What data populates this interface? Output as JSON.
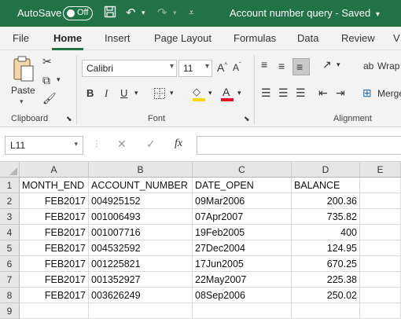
{
  "titlebar": {
    "autosave_label": "AutoSave",
    "toggle_state": "Off",
    "doc_title": "Account number query - Saved",
    "title_arrow": "▾"
  },
  "menu": [
    "File",
    "Home",
    "Insert",
    "Page Layout",
    "Formulas",
    "Data",
    "Review",
    "V"
  ],
  "ribbon": {
    "paste_label": "Paste",
    "font_name": "Calibri",
    "font_size": "11",
    "clipboard_label": "Clipboard",
    "font_label": "Font",
    "alignment_label": "Alignment",
    "bold": "B",
    "italic": "I",
    "underline": "U",
    "grow_font": "A^",
    "shrink_font": "Aˇ",
    "wrap_text": "Wrap",
    "merge": "Merge"
  },
  "formula_bar": {
    "name_box": "L11",
    "cancel": "✕",
    "enter": "✓",
    "fx": "fx",
    "value": ""
  },
  "sheet": {
    "columns": [
      "A",
      "B",
      "C",
      "D",
      "E"
    ],
    "rows": [
      "1",
      "2",
      "3",
      "4",
      "5",
      "6",
      "7",
      "8",
      "9"
    ],
    "header": [
      "MONTH_END",
      "ACCOUNT_NUMBER",
      "DATE_OPEN",
      "BALANCE"
    ],
    "data": [
      [
        "FEB2017",
        "004925152",
        "09Mar2006",
        "200.36"
      ],
      [
        "FEB2017",
        "001006493",
        "07Apr2007",
        "735.82"
      ],
      [
        "FEB2017",
        "001007716",
        "19Feb2005",
        "400"
      ],
      [
        "FEB2017",
        "004532592",
        "27Dec2004",
        "124.95"
      ],
      [
        "FEB2017",
        "001225821",
        "17Jun2005",
        "670.25"
      ],
      [
        "FEB2017",
        "001352927",
        "22May2007",
        "225.38"
      ],
      [
        "FEB2017",
        "003626249",
        "08Sep2006",
        "250.02"
      ]
    ]
  },
  "colors": {
    "excel_green": "#217346",
    "highlight_yellow": "#ffd800",
    "font_red": "#e81123"
  }
}
